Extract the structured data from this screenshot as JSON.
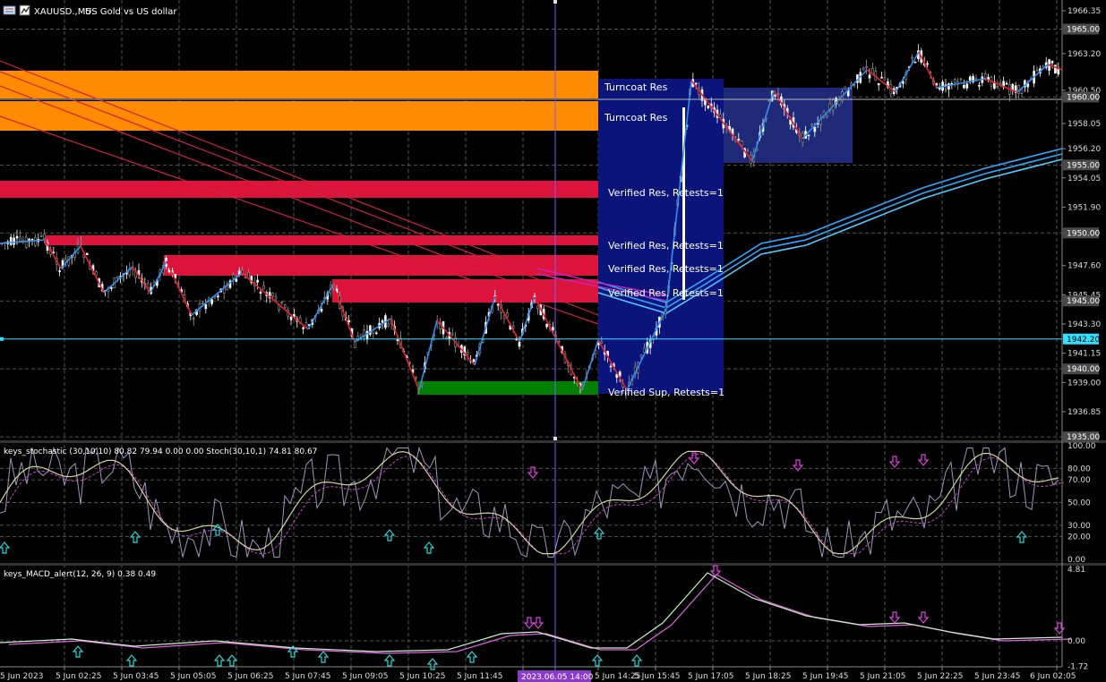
{
  "window": {
    "symbol_title": "XAUUSD.,M5:",
    "description": "US Gold vs US dollar"
  },
  "colors": {
    "background": "#000000",
    "bull_candle": "#ffffff",
    "bear_candle": "#9a9a9a",
    "zigzag_up": "#2f8ff5",
    "zigzag_down": "#e8202a",
    "turncoat_zone": "#ff8c00",
    "verified_res_zone": "#dc143c",
    "verified_sup_zone": "#008000",
    "session_box": "#0a147a",
    "session_box_2": "#1e2a78",
    "ma_cyan": "#2ea8ff",
    "price_line": "#33e0ff",
    "cursor_line": "#7a5cff",
    "up_arrow": "#26d7d7",
    "down_arrow": "#e040e0",
    "stoch_main": "#9999bb",
    "stoch_signal": "#d2d2a0",
    "macd_line": "#c8f0c8",
    "macd_signal": "#e060e0"
  },
  "zone_labels": [
    "Turncoat Res",
    "Turncoat Res",
    "Verified Res, Retests=1",
    "Verified Res, Retests=1",
    "Verified Res, Retests=1",
    "Verified Res, Retests=1",
    "Verified Sup, Retests=1"
  ],
  "price_axis": {
    "ticks": [
      "1966.35",
      "1963.20",
      "1960.50",
      "1958.05",
      "1956.20",
      "1954.05",
      "1951.90",
      "1947.60",
      "1945.45",
      "1943.30",
      "1941.15",
      "1939.00",
      "1936.85"
    ],
    "boxed": [
      "1965.00",
      "1960.00",
      "1955.00",
      "1950.00",
      "1945.00",
      "1940.00",
      "1935.00"
    ],
    "current_price": "1942.20"
  },
  "stochastic": {
    "title": "keys_stochastic (30,10,10) 80.82 79.94 0.00 0.00 Stoch(30,10,1) 74.81 80.67",
    "axis": [
      "100.00",
      "80.00",
      "70.00",
      "50.00",
      "30.00",
      "20.00",
      "0.00"
    ]
  },
  "macd": {
    "title": "keys_MACD_alert(12, 26, 9) 0.38 0.49",
    "axis": [
      "4.81",
      "0.00",
      "-1.72"
    ]
  },
  "time_axis": {
    "labels": [
      "5 Jun 2023",
      "5 Jun 02:25",
      "5 Jun 03:45",
      "5 Jun 05:05",
      "5 Jun 06:25",
      "5 Jun 07:45",
      "5 Jun 09:05",
      "5 Jun 10:25",
      "5 Jun 11:45",
      "5 Jun 14:25",
      "5 Jun 15:45",
      "5 Jun 17:05",
      "5 Jun 18:25",
      "5 Jun 19:45",
      "5 Jun 21:05",
      "5 Jun 22:25",
      "5 Jun 23:45",
      "6 Jun 02:05"
    ],
    "cursor_label": "2023.06.05 14:00"
  }
}
